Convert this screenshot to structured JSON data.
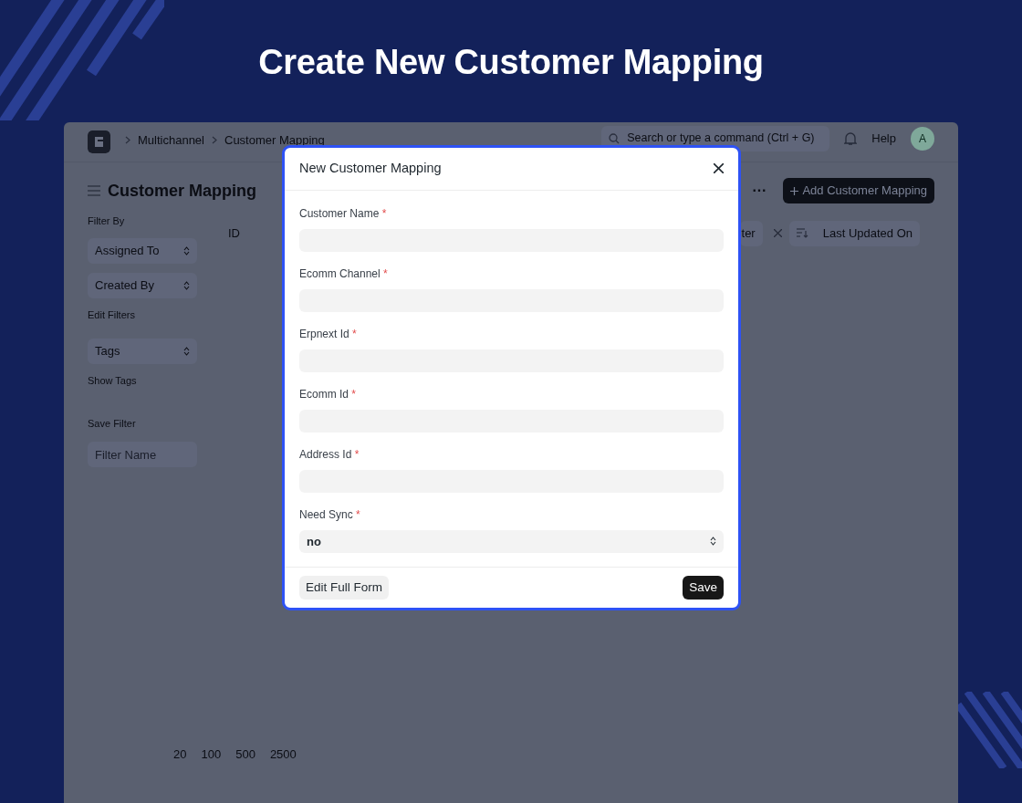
{
  "headline": "Create New Customer Mapping",
  "app": {
    "breadcrumbs": [
      "Multichannel",
      "Customer Mapping"
    ],
    "search": {
      "placeholder": "Search or type a command (Ctrl + G)"
    },
    "help": "Help",
    "avatar": "A",
    "page_title": "Customer Mapping",
    "menu_button": "···",
    "primary_button": "Add Customer Mapping",
    "sidebar": {
      "filter_by": "Filter By",
      "filters": [
        "Assigned To",
        "Created By"
      ],
      "edit_filters": "Edit Filters",
      "tags": "Tags",
      "show_tags": "Show Tags",
      "save_filter": "Save Filter",
      "filter_name_placeholder": "Filter Name"
    },
    "list": {
      "column": "ID",
      "filter_button": "ter",
      "sort_button": "Last Updated On",
      "page_sizes": [
        "20",
        "100",
        "500",
        "2500"
      ]
    }
  },
  "dialog": {
    "title": "New Customer Mapping",
    "fields": [
      {
        "label": "Customer Name",
        "required_mark": "*",
        "kind": "text"
      },
      {
        "label": "Ecomm Channel",
        "required_mark": "*",
        "kind": "text"
      },
      {
        "label": "Erpnext Id",
        "required_mark": "*",
        "kind": "text"
      },
      {
        "label": "Ecomm Id",
        "required_mark": "*",
        "kind": "text"
      },
      {
        "label": "Address Id",
        "required_mark": "*",
        "kind": "text"
      },
      {
        "label": "Need Sync",
        "required_mark": "*",
        "kind": "select",
        "value": "no"
      }
    ],
    "secondary_button": "Edit Full Form",
    "primary_button": "Save"
  }
}
